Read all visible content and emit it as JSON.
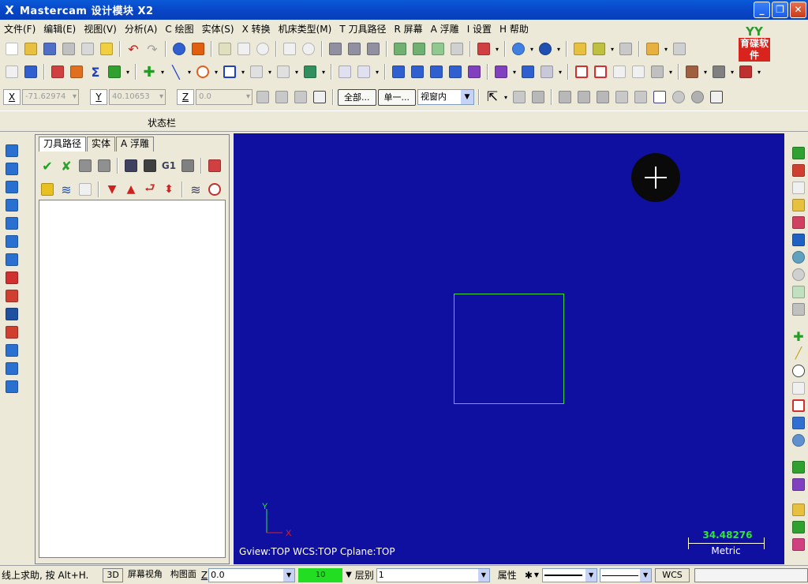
{
  "window": {
    "title": "Mastercam 设计模块  X2",
    "app_icon": "X",
    "buttons": [
      "_",
      "❐",
      "✕"
    ]
  },
  "menu": [
    "文件(F)",
    "编辑(E)",
    "视图(V)",
    "分析(A)",
    "C 绘图",
    "实体(S)",
    "X 转换",
    "机床类型(M)",
    "T 刀具路径",
    "R 屏幕",
    "A 浮雕",
    "I 设置",
    "H 帮助"
  ],
  "logo": {
    "top": "YY",
    "bottom": "育碟软件",
    "colors": {
      "top": "#2e9a2e",
      "bottom": "#d8241c"
    }
  },
  "coord_bar": {
    "x_label": "X",
    "x_value": "-71.62974",
    "y_label": "Y",
    "y_value": "40.10653",
    "z_label": "Z",
    "z_value": "0.0",
    "select_all": "全部...",
    "select_single": "单一...",
    "window_mode": "视窗内"
  },
  "status_label": "状态栏",
  "manager": {
    "tabs": [
      "刀具路径",
      "实体",
      "A 浮雕"
    ],
    "active_tab": "刀具路径",
    "gcode_label": "G1"
  },
  "viewport": {
    "background": "#1010a0",
    "geometry_color": "#3ddc3d",
    "axis_y": "Y",
    "axis_x": "X",
    "view_info": "Gview:TOP   WCS:TOP   Cplane:TOP",
    "scale_value": "34.48276",
    "scale_unit": "Metric"
  },
  "bottom": {
    "prompt": "线上求助, 按 Alt+H.",
    "btn_3d": "3D",
    "btn_screen_view": "屏幕视角",
    "btn_cplane": "构图面",
    "z_label": "Z",
    "z_value": "0.0",
    "color_value": "10",
    "color_swatch": "#22dd22",
    "level_label": "层别",
    "level_value": "1",
    "attributes": "属性",
    "point_style": "✱",
    "wcs": "WCS"
  }
}
